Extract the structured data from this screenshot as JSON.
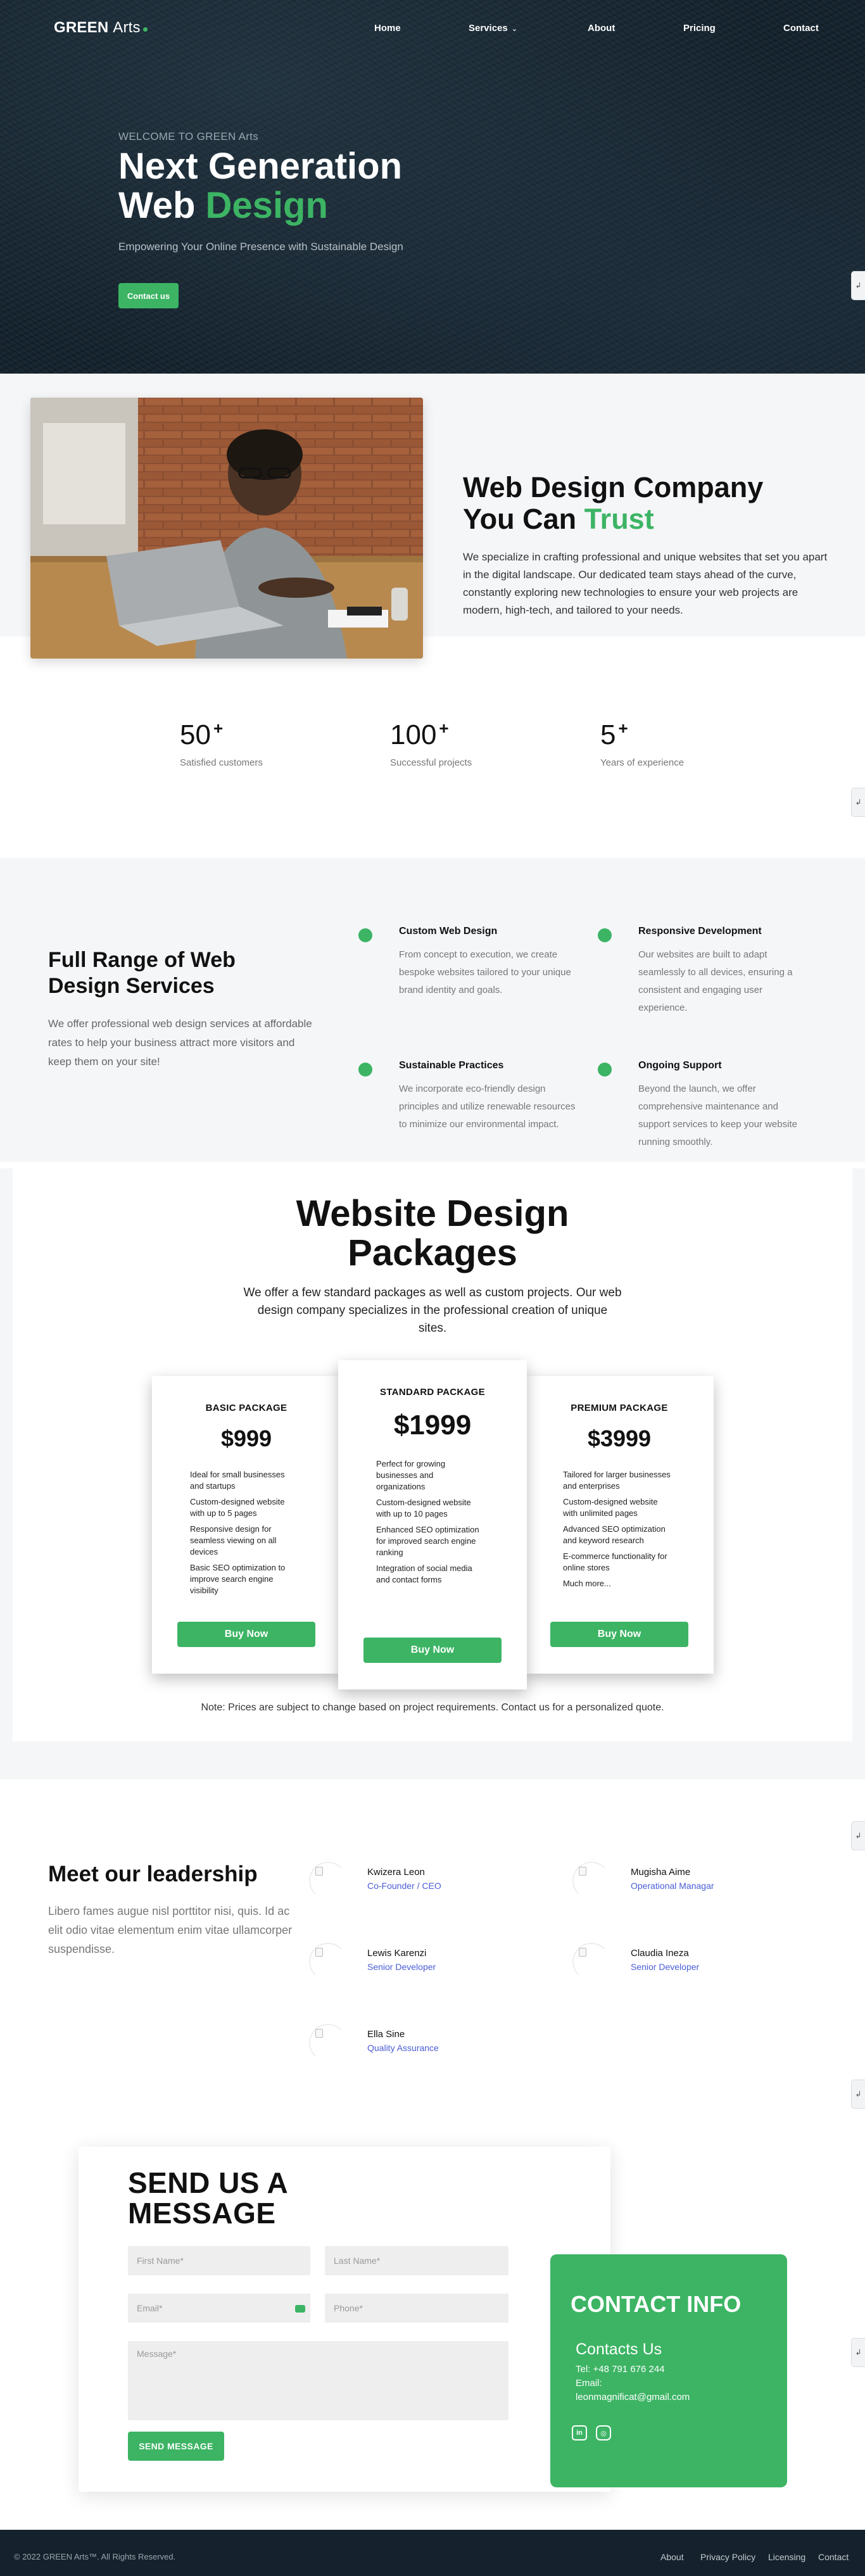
{
  "nav": {
    "logo_bold": "GREEN",
    "logo_regular": "Arts",
    "items": [
      {
        "label": "Home"
      },
      {
        "label": "Services"
      },
      {
        "label": "About"
      },
      {
        "label": "Pricing"
      },
      {
        "label": "Contact"
      }
    ]
  },
  "hero": {
    "kicker": "WELCOME TO GREEN Arts",
    "title_line1": "Next Generation",
    "title_line2_plain": "Web ",
    "title_line2_green": "Design",
    "subtitle": "Empowering Your Online Presence with Sustainable Design",
    "button": "Contact us"
  },
  "about": {
    "title_line1": "Web Design Company",
    "title_line2_plain": "You Can ",
    "title_line2_green": "Trust",
    "text": "We specialize in crafting professional and unique websites that set you apart in the digital landscape. Our dedicated team stays ahead of the curve, constantly exploring new technologies to ensure your web projects are modern, high-tech, and tailored to your needs."
  },
  "stats": [
    {
      "num": "50",
      "plus": "+",
      "label": "Satisfied customers"
    },
    {
      "num": "100",
      "plus": "+",
      "label": "Successful projects"
    },
    {
      "num": "5",
      "plus": "+",
      "label": "Years of experience"
    }
  ],
  "services": {
    "title": "Full Range of Web Design Services",
    "text": "We offer professional web design services at affordable rates to help your business attract more visitors and keep them on your site!",
    "items": [
      {
        "title": "Custom Web Design",
        "text": "From concept to execution, we create bespoke websites tailored to your unique brand identity and goals."
      },
      {
        "title": "Responsive Development",
        "text": "Our websites are built to adapt seamlessly to all devices, ensuring a consistent and engaging user experience."
      },
      {
        "title": "Sustainable Practices",
        "text": "We incorporate eco-friendly design principles and utilize renewable resources to minimize our environmental impact."
      },
      {
        "title": "Ongoing Support",
        "text": "Beyond the launch, we offer comprehensive maintenance and support services to keep your website running smoothly."
      }
    ]
  },
  "packages": {
    "title_line1": "Website Design",
    "title_line2": "Packages",
    "subtitle": "We offer a few standard packages as well as custom projects. Our web design company specializes in the professional creation of unique sites.",
    "buy_label": "Buy Now",
    "note": "Note: Prices are subject to change based on project requirements. Contact us for a personalized quote.",
    "cards": [
      {
        "name": "BASIC PACKAGE",
        "price": "$999",
        "features": [
          "Ideal for small businesses and startups",
          "Custom-designed website with up to 5 pages",
          "Responsive design for seamless viewing on all devices",
          "Basic SEO optimization to improve search engine visibility"
        ]
      },
      {
        "name": "STANDARD PACKAGE",
        "price": "$1999",
        "features": [
          "Perfect for growing businesses and organizations",
          "Custom-designed website with up to 10 pages",
          "Enhanced SEO optimization for improved search engine ranking",
          "Integration of social media and contact forms"
        ]
      },
      {
        "name": "PREMIUM PACKAGE",
        "price": "$3999",
        "features": [
          "Tailored for larger businesses and enterprises",
          "Custom-designed website with unlimited pages",
          "Advanced SEO optimization and keyword research",
          "E-commerce functionality for online stores",
          "Much more..."
        ]
      }
    ]
  },
  "leadership": {
    "title": "Meet our leadership",
    "text": "Libero fames augue nisl porttitor nisi, quis. Id ac elit odio vitae elementum enim vitae ullamcorper suspendisse.",
    "members": [
      {
        "name": "Kwizera Leon",
        "role": "Co-Founder / CEO"
      },
      {
        "name": "Mugisha Aime",
        "role": "Operational Managar"
      },
      {
        "name": "Lewis Karenzi",
        "role": "Senior Developer"
      },
      {
        "name": "Claudia Ineza",
        "role": "Senior Developer"
      },
      {
        "name": "Ella Sine",
        "role": "Quality Assurance"
      }
    ]
  },
  "contact": {
    "form_title_line1": "SEND US A",
    "form_title_line2": "MESSAGE",
    "first_name_placeholder": "First Name*",
    "last_name_placeholder": "Last Name*",
    "email_placeholder": "Email*",
    "phone_placeholder": "Phone*",
    "message_placeholder": "Message*",
    "send_label": "SEND MESSAGE",
    "info_title": "CONTACT INFO",
    "info_sub": "Contacts Us",
    "tel": "Tel: +48 791 676 244",
    "email_label": "Email:",
    "email": "leonmagnificat@gmail.com",
    "social": [
      {
        "icon": "linkedin-icon",
        "glyph": "in"
      },
      {
        "icon": "instagram-icon",
        "glyph": "◎"
      }
    ]
  },
  "footer": {
    "copy": "© 2022 GREEN Arts™. All Rights Reserved.",
    "links": [
      {
        "label": "About"
      },
      {
        "label": "Privacy Policy"
      },
      {
        "label": "Licensing"
      },
      {
        "label": "Contact"
      }
    ]
  },
  "colors": {
    "accent": "#3cb464",
    "hero_bg": "#16242f",
    "section_bg": "#f5f6f8",
    "role_link": "#4a5cd6",
    "footer_bg": "#15212c"
  }
}
